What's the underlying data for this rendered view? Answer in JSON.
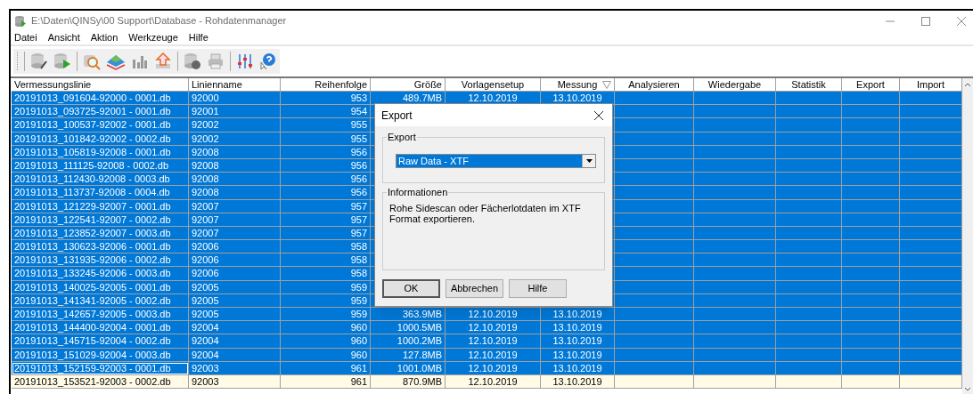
{
  "window": {
    "title": "E:\\Daten\\QINSy\\00 Support\\Database - Rohdatenmanager"
  },
  "menu": [
    "Datei",
    "Ansicht",
    "Aktion",
    "Werkzeuge",
    "Hilfe"
  ],
  "table": {
    "columns": [
      {
        "label": "Vermessungslinie",
        "sorted": false
      },
      {
        "label": "Linienname",
        "sorted": false
      },
      {
        "label": "Reihenfolge",
        "sorted": false
      },
      {
        "label": "Größe",
        "sorted": false
      },
      {
        "label": "Vorlagensetup",
        "sorted": false
      },
      {
        "label": "Messung",
        "sorted": true
      },
      {
        "label": "Analysieren",
        "sorted": false
      },
      {
        "label": "Wiedergabe",
        "sorted": false
      },
      {
        "label": "Statistik",
        "sorted": false
      },
      {
        "label": "Export",
        "sorted": false
      },
      {
        "label": "Import",
        "sorted": false
      }
    ],
    "rows": [
      {
        "selected": true,
        "focused": false,
        "cells": [
          "20191013_091604-92000 - 0001.db",
          "92000",
          "953",
          "489.7MB",
          "12.10.2019",
          "13.10.2019"
        ]
      },
      {
        "selected": true,
        "focused": false,
        "cells": [
          "20191013_093725-92001 - 0001.db",
          "92001",
          "954"
        ]
      },
      {
        "selected": true,
        "focused": false,
        "cells": [
          "20191013_100537-92002 - 0001.db",
          "92002",
          "955"
        ]
      },
      {
        "selected": true,
        "focused": false,
        "cells": [
          "20191013_101842-92002 - 0002.db",
          "92002",
          "955"
        ]
      },
      {
        "selected": true,
        "focused": false,
        "cells": [
          "20191013_105819-92008 - 0001.db",
          "92008",
          "956"
        ]
      },
      {
        "selected": true,
        "focused": false,
        "cells": [
          "20191013_111125-92008 - 0002.db",
          "92008",
          "956"
        ]
      },
      {
        "selected": true,
        "focused": false,
        "cells": [
          "20191013_112430-92008 - 0003.db",
          "92008",
          "956"
        ]
      },
      {
        "selected": true,
        "focused": false,
        "cells": [
          "20191013_113737-92008 - 0004.db",
          "92008",
          "956"
        ]
      },
      {
        "selected": true,
        "focused": false,
        "cells": [
          "20191013_121229-92007 - 0001.db",
          "92007",
          "957"
        ]
      },
      {
        "selected": true,
        "focused": false,
        "cells": [
          "20191013_122541-92007 - 0002.db",
          "92007",
          "957"
        ]
      },
      {
        "selected": true,
        "focused": false,
        "cells": [
          "20191013_123852-92007 - 0003.db",
          "92007",
          "957"
        ]
      },
      {
        "selected": true,
        "focused": false,
        "cells": [
          "20191013_130623-92006 - 0001.db",
          "92006",
          "958"
        ]
      },
      {
        "selected": true,
        "focused": false,
        "cells": [
          "20191013_131935-92006 - 0002.db",
          "92006",
          "958"
        ]
      },
      {
        "selected": true,
        "focused": false,
        "cells": [
          "20191013_133245-92006 - 0003.db",
          "92006",
          "958"
        ]
      },
      {
        "selected": true,
        "focused": false,
        "cells": [
          "20191013_140025-92005 - 0001.db",
          "92005",
          "959"
        ]
      },
      {
        "selected": true,
        "focused": false,
        "cells": [
          "20191013_141341-92005 - 0002.db",
          "92005",
          "959"
        ]
      },
      {
        "selected": true,
        "focused": false,
        "cells": [
          "20191013_142657-92005 - 0003.db",
          "92005",
          "959",
          "363.9MB",
          "12.10.2019",
          "13.10.2019"
        ]
      },
      {
        "selected": true,
        "focused": false,
        "cells": [
          "20191013_144400-92004 - 0001.db",
          "92004",
          "960",
          "1000.5MB",
          "12.10.2019",
          "13.10.2019"
        ]
      },
      {
        "selected": true,
        "focused": false,
        "cells": [
          "20191013_145715-92004 - 0002.db",
          "92004",
          "960",
          "1000.2MB",
          "12.10.2019",
          "13.10.2019"
        ]
      },
      {
        "selected": true,
        "focused": false,
        "cells": [
          "20191013_151029-92004 - 0003.db",
          "92004",
          "960",
          "127.8MB",
          "12.10.2019",
          "13.10.2019"
        ]
      },
      {
        "selected": true,
        "focused": true,
        "cells": [
          "20191013_152159-92003 - 0001.db",
          "92003",
          "961",
          "1001.0MB",
          "12.10.2019",
          "13.10.2019"
        ]
      },
      {
        "selected": false,
        "focused": false,
        "cells": [
          "20191013_153521-92003 - 0002.db",
          "92003",
          "961",
          "870.9MB",
          "12.10.2019",
          "13.10.2019"
        ]
      }
    ]
  },
  "dialog": {
    "title": "Export",
    "export_group": {
      "label": "Export",
      "dropdown": {
        "value": "Raw Data - XTF"
      }
    },
    "info_group": {
      "label": "Informationen",
      "text": "Rohe Sidescan oder Fächerlotdaten im XTF Format exportieren."
    },
    "buttons": [
      {
        "label": "OK",
        "default": true
      },
      {
        "label": "Abbrechen",
        "default": false
      },
      {
        "label": "Hilfe",
        "default": false
      }
    ]
  }
}
